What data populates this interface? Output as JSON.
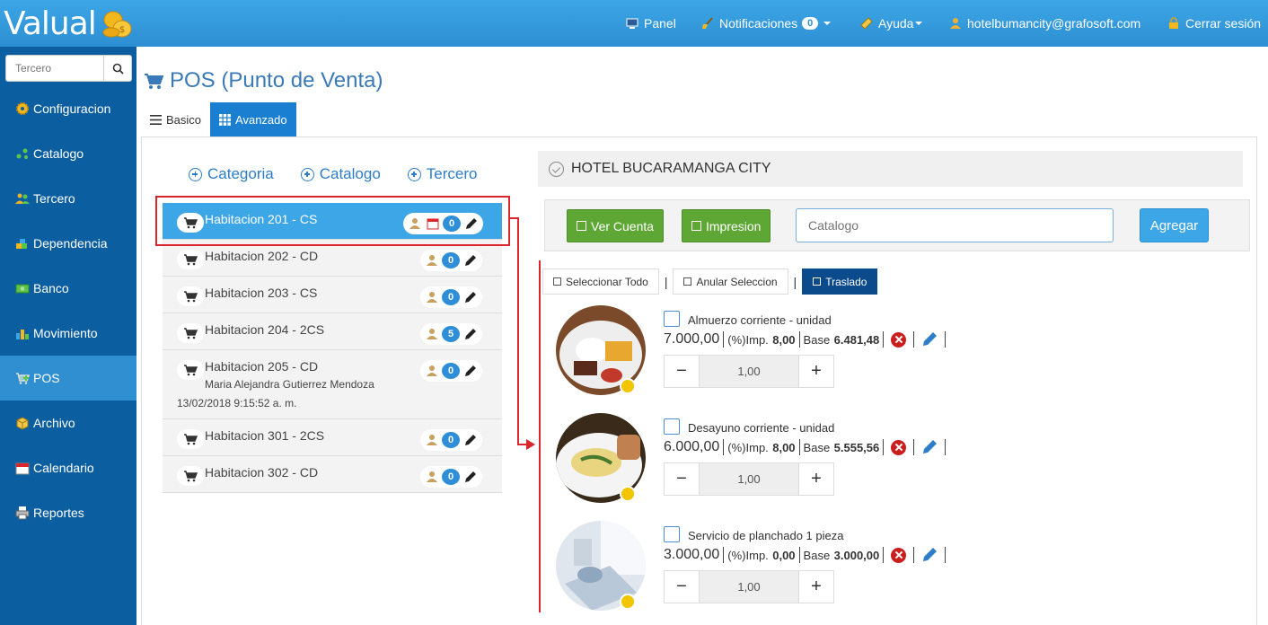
{
  "app": {
    "logo": "Valual"
  },
  "topnav": {
    "panel": "Panel",
    "notificaciones": "Notificaciones",
    "notif_count": "0",
    "ayuda": "Ayuda",
    "user": "hotelbumancity@grafosoft.com",
    "logout": "Cerrar sesión"
  },
  "sidebar": {
    "search_placeholder": "Tercero",
    "items": [
      {
        "label": "Configuracion",
        "icon": "gear-icon"
      },
      {
        "label": "Catalogo",
        "icon": "dots-icon"
      },
      {
        "label": "Tercero",
        "icon": "people-icon"
      },
      {
        "label": "Dependencia",
        "icon": "blocks-icon"
      },
      {
        "label": "Banco",
        "icon": "money-icon"
      },
      {
        "label": "Movimiento",
        "icon": "chart-icon"
      },
      {
        "label": "POS",
        "icon": "cart-add-icon"
      },
      {
        "label": "Archivo",
        "icon": "box-icon"
      },
      {
        "label": "Calendario",
        "icon": "calendar-icon"
      },
      {
        "label": "Reportes",
        "icon": "printer-icon"
      }
    ],
    "active": "POS"
  },
  "page": {
    "title": "POS (Punto de Venta)",
    "tab_basic": "Basico",
    "tab_advanced": "Avanzado"
  },
  "links": {
    "categoria": "Categoria",
    "catalogo": "Catalogo",
    "tercero": "Tercero"
  },
  "rooms": [
    {
      "name": "Habitacion 201 - CS",
      "count": "0"
    },
    {
      "name": "Habitacion 202 - CD",
      "count": "0"
    },
    {
      "name": "Habitacion 203 - CS",
      "count": "0"
    },
    {
      "name": "Habitacion 204 - 2CS",
      "count": "5"
    },
    {
      "name": "Habitacion 205 - CD",
      "count": "0",
      "guest": "Maria Alejandra Gutierrez Mendoza",
      "date": "13/02/2018 9:15:52 a. m."
    },
    {
      "name": "Habitacion 301 - 2CS",
      "count": "0"
    },
    {
      "name": "Habitacion 302 - CD",
      "count": "0"
    }
  ],
  "hotel": {
    "name": "HOTEL BUCARAMANGA CITY"
  },
  "toolbar": {
    "ver_cuenta": "Ver Cuenta",
    "impresion": "Impresion",
    "catalogo_placeholder": "Catalogo",
    "agregar": "Agregar"
  },
  "selection": {
    "seleccionar_todo": "Seleccionar Todo",
    "anular": "Anular Seleccion",
    "traslado": "Traslado",
    "sep": "|"
  },
  "products": [
    {
      "name": "Almuerzo corriente - unidad",
      "price": "7.000,00",
      "imp_label": "(%)Imp.",
      "imp": "8,00",
      "base_label": "Base",
      "base": "6.481,48",
      "qty": "1,00"
    },
    {
      "name": "Desayuno corriente - unidad",
      "price": "6.000,00",
      "imp_label": "(%)Imp.",
      "imp": "8,00",
      "base_label": "Base",
      "base": "5.555,56",
      "qty": "1,00"
    },
    {
      "name": "Servicio de planchado 1 pieza",
      "price": "3.000,00",
      "imp_label": "(%)Imp.",
      "imp": "0,00",
      "base_label": "Base",
      "base": "3.000,00",
      "qty": "1,00"
    }
  ]
}
